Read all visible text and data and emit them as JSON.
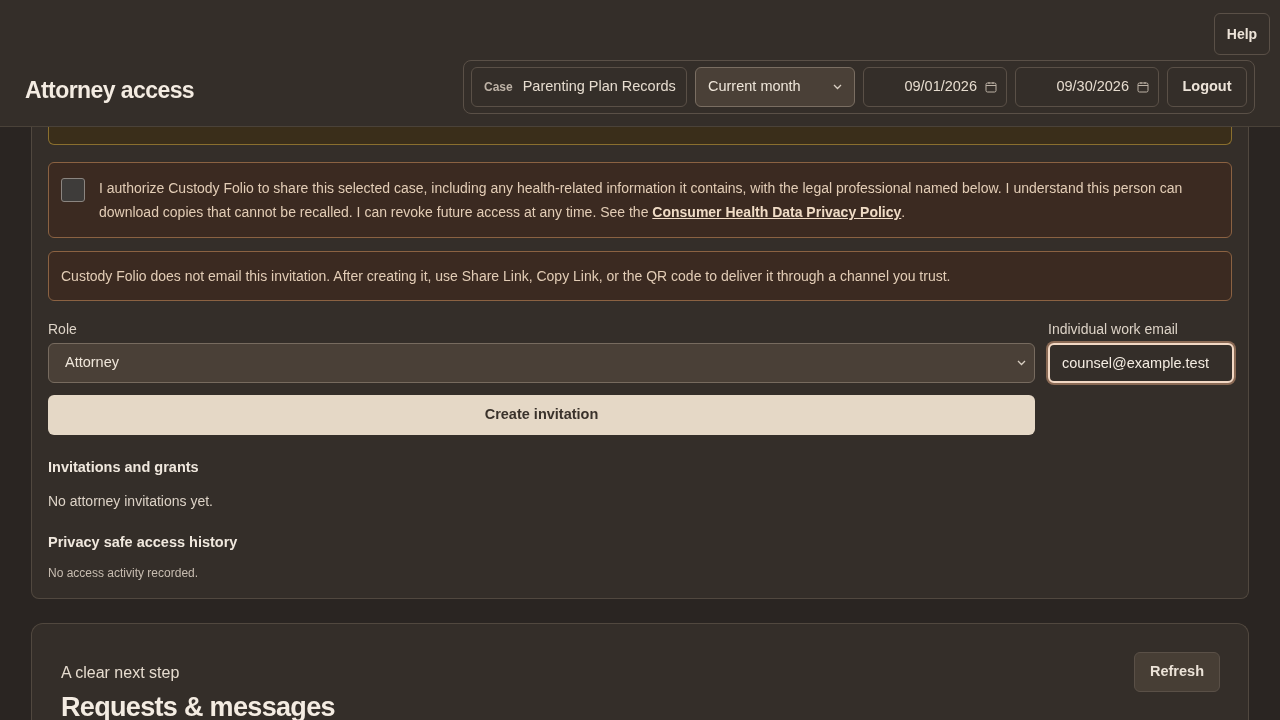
{
  "header": {
    "title": "Attorney access",
    "help_button": "Help",
    "case": {
      "label": "Case",
      "value": "Parenting Plan Records"
    },
    "period": {
      "value": "Current month"
    },
    "start_date": "09/01/2026",
    "end_date": "09/30/2026",
    "logout_button": "Logout"
  },
  "consent": {
    "checked": false,
    "text_before": "I authorize Custody Folio to share this selected case, including any health-related information it contains, with the legal professional named below. I understand this person can download copies that cannot be recalled. I can revoke future access at any time. See the ",
    "link": "Consumer Health Data Privacy Policy",
    "text_after": "."
  },
  "notice": "Custody Folio does not email this invitation. After creating it, use Share Link, Copy Link, or the QR code to deliver it through a channel you trust.",
  "role": {
    "label": "Role",
    "value": "Attorney"
  },
  "email": {
    "label": "Individual work email",
    "value": "counsel@example.test",
    "focused": true
  },
  "create_button": "Create invitation",
  "sections": [
    {
      "heading": "Invitations and grants",
      "body": "No attorney invitations yet.",
      "kind": "normal"
    },
    {
      "heading": "Privacy safe access history",
      "body": "No access activity recorded.",
      "kind": "small"
    }
  ],
  "next_card": {
    "eyebrow": "A clear next step",
    "title": "Requests & messages",
    "refresh_button": "Refresh"
  }
}
